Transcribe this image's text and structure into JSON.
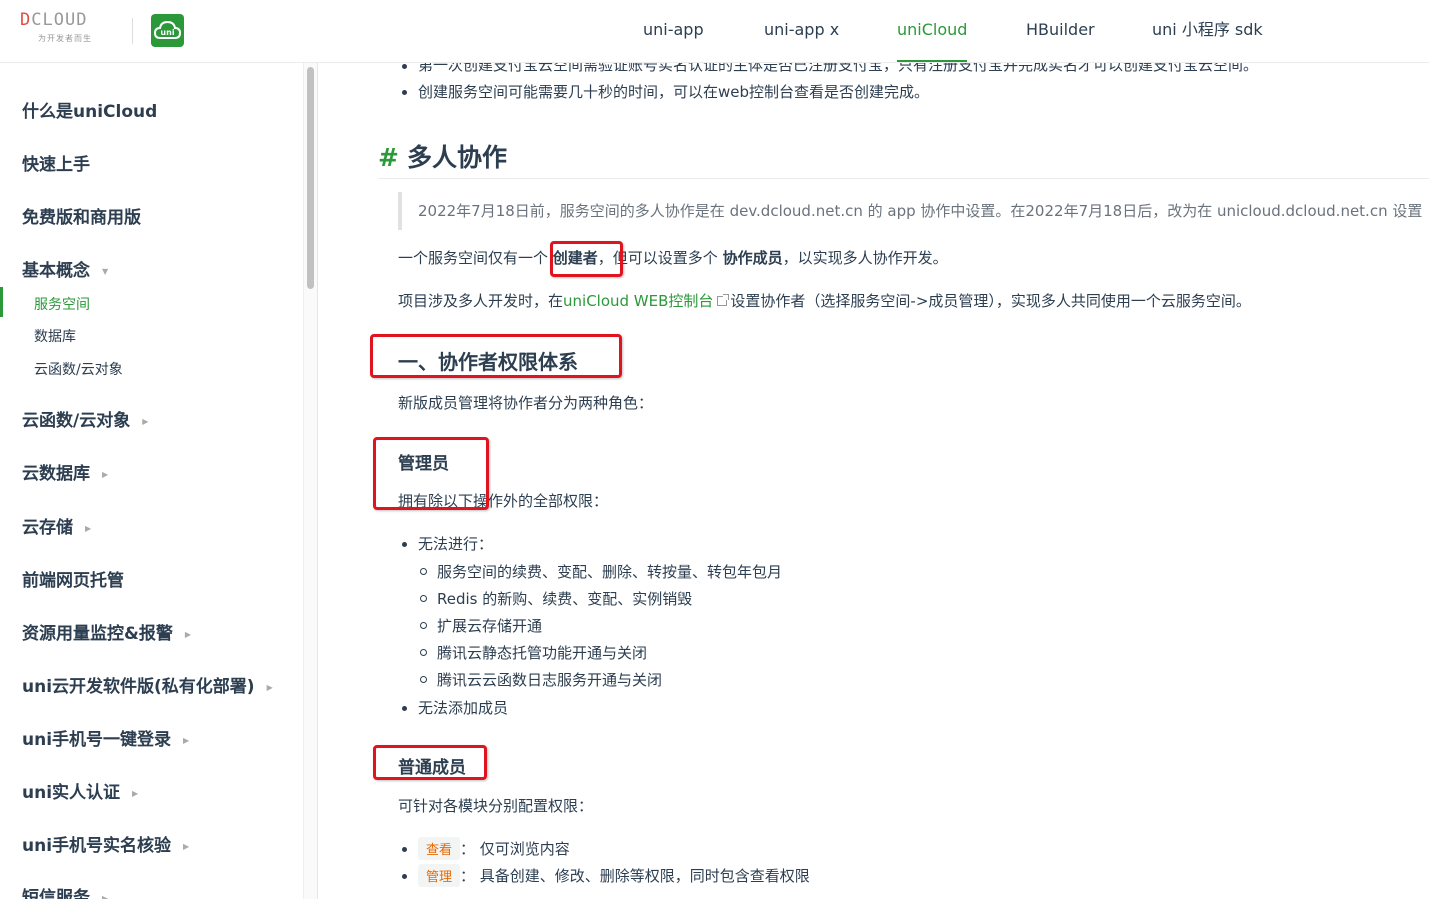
{
  "header": {
    "logo_text": "DCLOUD",
    "logo_slogan": "为开发者而生",
    "uni_logo_text": "uni",
    "nav": [
      "uni-app",
      "uni-app x",
      "uniCloud",
      "HBuilder",
      "uni 小程序 sdk"
    ],
    "active_nav": "uniCloud"
  },
  "sidebar": {
    "items": [
      {
        "label": "什么是uniCloud"
      },
      {
        "label": "快速上手"
      },
      {
        "label": "免费版和商用版"
      },
      {
        "label": "基本概念"
      },
      {
        "label": "云函数/云对象"
      },
      {
        "label": "云数据库"
      },
      {
        "label": "云存储"
      },
      {
        "label": "前端网页托管"
      },
      {
        "label": "资源用量监控&报警"
      },
      {
        "label": "uni云开发软件版(私有化部署)"
      },
      {
        "label": "uni手机号一键登录"
      },
      {
        "label": "uni实人认证"
      },
      {
        "label": "uni手机号实名核验"
      },
      {
        "label": "短信服务"
      }
    ],
    "sub_items": [
      "服务空间",
      "数据库",
      "云函数/云对象"
    ],
    "active_sub": "服务空间"
  },
  "content": {
    "top_bullets": [
      "第一次创建支付宝云空间需验证账号实名认证的主体是否已注册支付宝，只有注册支付宝并完成实名才可以创建支付宝云空间。",
      "创建服务空间可能需要几十秒的时间，可以在web控制台查看是否创建完成。"
    ],
    "h2_hash": "#",
    "h2": "多人协作",
    "quote": "2022年7月18日前，服务空间的多人协作是在 dev.dcloud.net.cn 的 app 协作中设置。在2022年7月18日后，改为在 unicloud.dcloud.net.cn 设置",
    "p1": {
      "a": "一个服务空间仅有一个 ",
      "creator": "创建者",
      "b": "，但可以设置多个 ",
      "member": "协作成员",
      "c": "，以实现多人协作开发。"
    },
    "p2": {
      "a": "项目涉及多人开发时，在",
      "link": "uniCloud WEB控制台",
      "b": "设置协作者（选择服务空间->成员管理），实现多人共同使用一个云服务空间。"
    },
    "h3": "一、协作者权限体系",
    "p3": "新版成员管理将协作者分为两种角色：",
    "admin_title": "管理员",
    "admin_desc": "拥有除以下操作外的全部权限：",
    "admin_list": {
      "item1": "无法进行：",
      "sub": [
        "服务空间的续费、变配、删除、转按量、转包年包月",
        "Redis 的新购、续费、变配、实例销毁",
        "扩展云存储开通",
        "腾讯云静态托管功能开通与关闭",
        "腾讯云云函数日志服务开通与关闭"
      ],
      "item2": "无法添加成员"
    },
    "member_title": "普通成员",
    "member_desc": "可针对各模块分别配置权限：",
    "member_list": [
      {
        "tag": "查看",
        "text": "：  仅可浏览内容"
      },
      {
        "tag": "管理",
        "text": "：  具备创建、修改、删除等权限，同时包含查看权限"
      }
    ]
  },
  "colors": {
    "brand": "#2b9939",
    "highlight_box": "#e0141e",
    "tag_text": "#e96900"
  }
}
